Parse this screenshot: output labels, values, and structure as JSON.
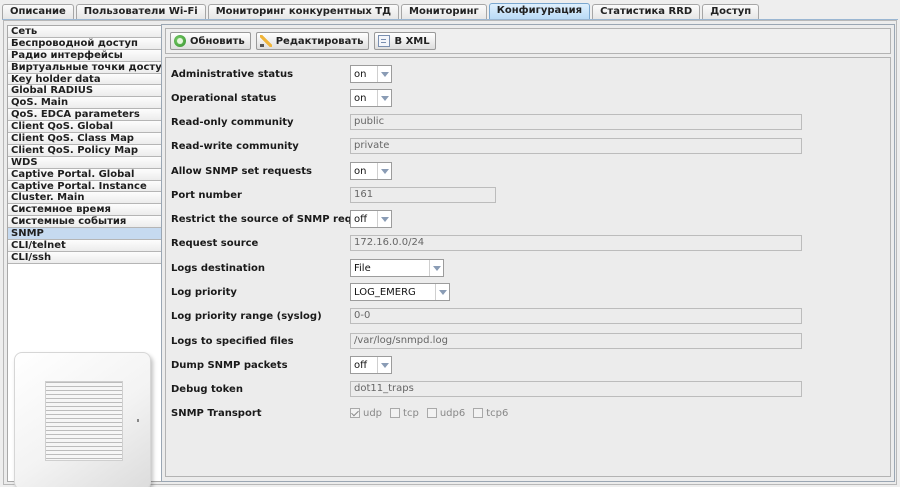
{
  "tabs": [
    {
      "label": "Описание",
      "active": false
    },
    {
      "label": "Пользователи Wi-Fi",
      "active": false
    },
    {
      "label": "Мониторинг конкурентных ТД",
      "active": false
    },
    {
      "label": "Мониторинг",
      "active": false
    },
    {
      "label": "Конфигурация",
      "active": true
    },
    {
      "label": "Статистика RRD",
      "active": false
    },
    {
      "label": "Доступ",
      "active": false
    }
  ],
  "sidebar": {
    "items": [
      "Сеть",
      "Беспроводной доступ",
      "Радио интерфейсы",
      "Виртуальные точки доступа",
      "Key holder data",
      "Global RADIUS",
      "QoS. Main",
      "QoS. EDCA parameters",
      "Client QoS. Global",
      "Client QoS. Class Map",
      "Client QoS. Policy Map",
      "WDS",
      "Captive Portal. Global",
      "Captive Portal. Instance",
      "Cluster. Main",
      "Системное время",
      "Системные события",
      "SNMP",
      "CLI/telnet",
      "CLI/ssh"
    ],
    "active_index": 17
  },
  "toolbar": {
    "refresh_label": "Обновить",
    "edit_label": "Редактировать",
    "xml_label": "В XML"
  },
  "form": {
    "administrative_status": {
      "label": "Administrative status",
      "value": "on"
    },
    "operational_status": {
      "label": "Operational status",
      "value": "on"
    },
    "read_only_community": {
      "label": "Read-only community",
      "value": "public"
    },
    "read_write_community": {
      "label": "Read-write community",
      "value": "private"
    },
    "allow_set": {
      "label": "Allow SNMP set requests",
      "value": "on"
    },
    "port_number": {
      "label": "Port number",
      "value": "161"
    },
    "restrict_source": {
      "label": "Restrict the source of SNMP requests",
      "value": "off"
    },
    "request_source": {
      "label": "Request source",
      "value": "172.16.0.0/24"
    },
    "logs_destination": {
      "label": "Logs destination",
      "value": "File"
    },
    "log_priority": {
      "label": "Log priority",
      "value": "LOG_EMERG"
    },
    "log_priority_range": {
      "label": "Log priority range (syslog)",
      "value": "0-0"
    },
    "logs_files": {
      "label": "Logs to specified files",
      "value": "/var/log/snmpd.log"
    },
    "dump_packets": {
      "label": "Dump SNMP packets",
      "value": "off"
    },
    "debug_token": {
      "label": "Debug token",
      "value": "dot11_traps"
    },
    "snmp_transport": {
      "label": "SNMP Transport",
      "options": [
        {
          "label": "udp",
          "checked": true
        },
        {
          "label": "tcp",
          "checked": false
        },
        {
          "label": "udp6",
          "checked": false
        },
        {
          "label": "tcp6",
          "checked": false
        }
      ]
    }
  }
}
